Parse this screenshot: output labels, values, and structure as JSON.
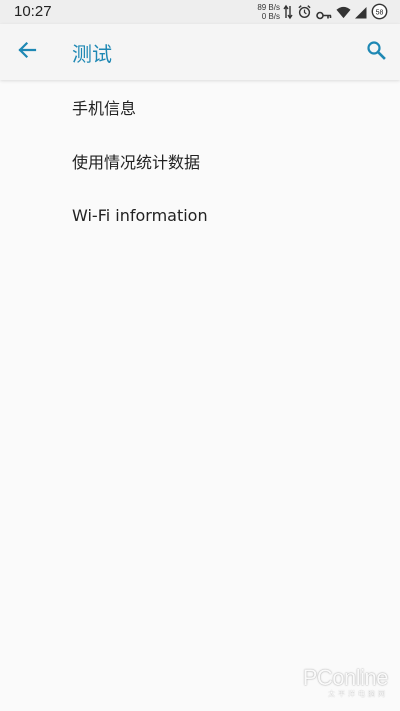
{
  "status_bar": {
    "time": "10:27",
    "net_speed_up": "89 B/s",
    "net_speed_down": "0 B/s",
    "battery_level": "58",
    "icons": [
      "data-transfer-icon",
      "alarm-icon",
      "vpn-key-icon",
      "wifi-icon",
      "cellular-signal-icon",
      "battery-icon"
    ]
  },
  "app_bar": {
    "title": "测试",
    "accent_color": "#1e88b4",
    "back_icon": "arrow-back-icon",
    "search_icon": "search-icon"
  },
  "settings_list": {
    "items": [
      {
        "label": "手机信息"
      },
      {
        "label": "使用情况统计数据"
      },
      {
        "label": "Wi-Fi information"
      }
    ]
  },
  "watermark": {
    "main": "PConline",
    "sub": "太平洋电脑网"
  }
}
